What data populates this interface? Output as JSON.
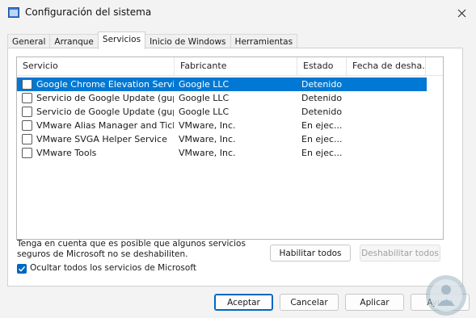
{
  "window": {
    "title": "Configuración del sistema"
  },
  "tabs": [
    {
      "label": "General"
    },
    {
      "label": "Arranque"
    },
    {
      "label": "Servicios",
      "active": true
    },
    {
      "label": "Inicio de Windows"
    },
    {
      "label": "Herramientas"
    }
  ],
  "columns": [
    "Servicio",
    "Fabricante",
    "Estado",
    "Fecha de desha..."
  ],
  "services": [
    {
      "name": "Google Chrome Elevation Servic...",
      "vendor": "Google LLC",
      "status": "Detenido",
      "selected": true,
      "checked": false
    },
    {
      "name": "Servicio de Google Update (gup...",
      "vendor": "Google LLC",
      "status": "Detenido",
      "checked": false
    },
    {
      "name": "Servicio de Google Update (gup...",
      "vendor": "Google LLC",
      "status": "Detenido",
      "checked": false
    },
    {
      "name": "VMware Alias Manager and Ticke...",
      "vendor": "VMware, Inc.",
      "status": "En ejec...",
      "checked": false
    },
    {
      "name": "VMware SVGA Helper Service",
      "vendor": "VMware, Inc.",
      "status": "En ejec...",
      "checked": false
    },
    {
      "name": "VMware Tools",
      "vendor": "VMware, Inc.",
      "status": "En ejec...",
      "checked": false
    }
  ],
  "note": {
    "line1": "Tenga en cuenta que es posible que algunos servicios",
    "line2": "seguros de Microsoft no se deshabiliten."
  },
  "buttons": {
    "enable_all": "Habilitar todos",
    "disable_all": "Deshabilitar todos",
    "ok": "Aceptar",
    "cancel": "Cancelar",
    "apply": "Aplicar",
    "help": "Ayuda"
  },
  "hide_ms": {
    "label": "Ocultar todos los servicios de Microsoft",
    "checked": true
  },
  "colors": {
    "accent": "#0067c0",
    "selection": "#0078d4"
  },
  "icons": {
    "app": "system-config-icon",
    "close": "close-icon"
  }
}
